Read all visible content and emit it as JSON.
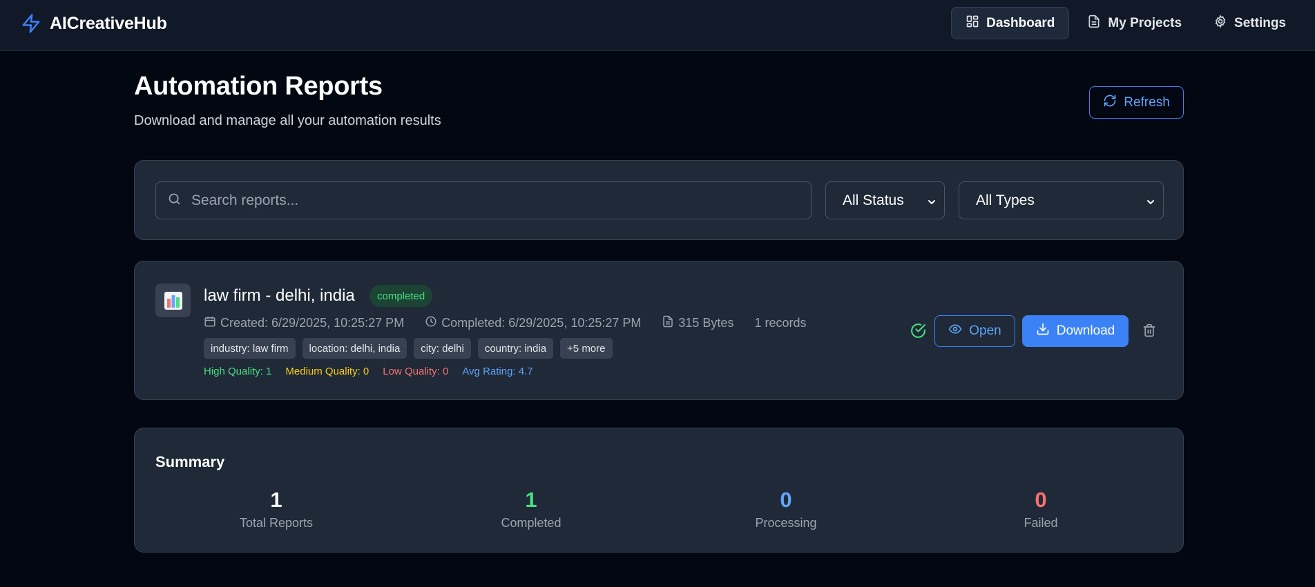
{
  "app": {
    "name": "AICreativeHub"
  },
  "nav": {
    "items": [
      {
        "label": "Dashboard",
        "icon": "dashboard-icon",
        "active": true
      },
      {
        "label": "My Projects",
        "icon": "file-icon",
        "active": false
      },
      {
        "label": "Settings",
        "icon": "gear-icon",
        "active": false
      }
    ]
  },
  "header": {
    "title": "Automation Reports",
    "subtitle": "Download and manage all your automation results",
    "refresh_label": "Refresh"
  },
  "filters": {
    "search_placeholder": "Search reports...",
    "status_value": "All Status",
    "type_value": "All Types"
  },
  "reports": [
    {
      "title": "law firm - delhi, india",
      "status": "completed",
      "created": "Created: 6/29/2025, 10:25:27 PM",
      "completed": "Completed: 6/29/2025, 10:25:27 PM",
      "size": "315 Bytes",
      "records": "1 records",
      "tags": [
        "industry: law firm",
        "location: delhi, india",
        "city: delhi",
        "country: india",
        "+5 more"
      ],
      "quality": {
        "high": "High Quality: 1",
        "medium": "Medium Quality: 0",
        "low": "Low Quality: 0",
        "avg": "Avg Rating: 4.7"
      },
      "open_label": "Open",
      "download_label": "Download"
    }
  ],
  "summary": {
    "title": "Summary",
    "stats": [
      {
        "value": "1",
        "label": "Total Reports"
      },
      {
        "value": "1",
        "label": "Completed"
      },
      {
        "value": "0",
        "label": "Processing"
      },
      {
        "value": "0",
        "label": "Failed"
      }
    ]
  },
  "colors": {
    "accent": "#3b82f6",
    "success": "#4ade80",
    "warning": "#facc15",
    "danger": "#f87171",
    "background": "#030712",
    "card": "#1f2937"
  }
}
